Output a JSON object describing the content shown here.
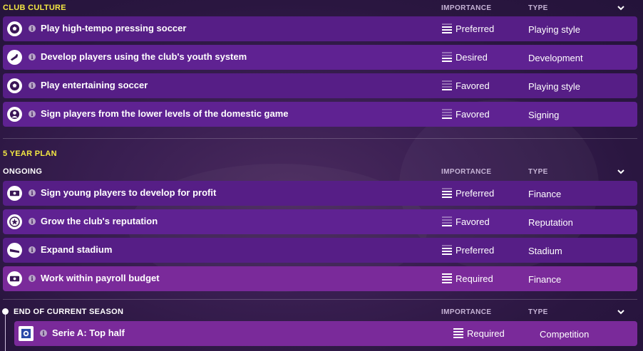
{
  "club_culture": {
    "title": "CLUB CULTURE",
    "col_importance": "IMPORTANCE",
    "col_type": "TYPE",
    "rows": [
      {
        "icon": "soccer-ball-icon",
        "label": "Play high-tempo pressing soccer",
        "importance": "Preferred",
        "level": 3,
        "type": "Playing style"
      },
      {
        "icon": "youth-boot-icon",
        "label": "Develop players using the club's youth system",
        "importance": "Desired",
        "level": 2,
        "type": "Development"
      },
      {
        "icon": "soccer-ball-icon",
        "label": "Play entertaining soccer",
        "importance": "Favored",
        "level": 1,
        "type": "Playing style"
      },
      {
        "icon": "person-icon",
        "label": "Sign players from the lower levels of the domestic game",
        "importance": "Favored",
        "level": 1,
        "type": "Signing"
      }
    ]
  },
  "five_year_plan": {
    "title": "5 YEAR PLAN",
    "ongoing_title": "ONGOING",
    "col_importance": "IMPORTANCE",
    "col_type": "TYPE",
    "rows": [
      {
        "icon": "money-icon",
        "label": "Sign young players to develop for profit",
        "importance": "Preferred",
        "level": 3,
        "type": "Finance"
      },
      {
        "icon": "star-icon",
        "label": "Grow the club's reputation",
        "importance": "Favored",
        "level": 1,
        "type": "Reputation"
      },
      {
        "icon": "stadium-icon",
        "label": "Expand stadium",
        "importance": "Preferred",
        "level": 3,
        "type": "Stadium"
      },
      {
        "icon": "money-icon",
        "label": "Work within payroll budget",
        "importance": "Required",
        "level": 4,
        "type": "Finance"
      }
    ]
  },
  "end_of_season": {
    "title": "END OF CURRENT SEASON",
    "col_importance": "IMPORTANCE",
    "col_type": "TYPE",
    "rows": [
      {
        "icon": "competition-badge-icon",
        "label": "Serie A: Top half",
        "importance": "Required",
        "level": 4,
        "type": "Competition"
      }
    ]
  },
  "colors": {
    "accent_yellow": "#f4e842",
    "row_purple": "#561e86",
    "row_required": "#7a2a9a"
  }
}
